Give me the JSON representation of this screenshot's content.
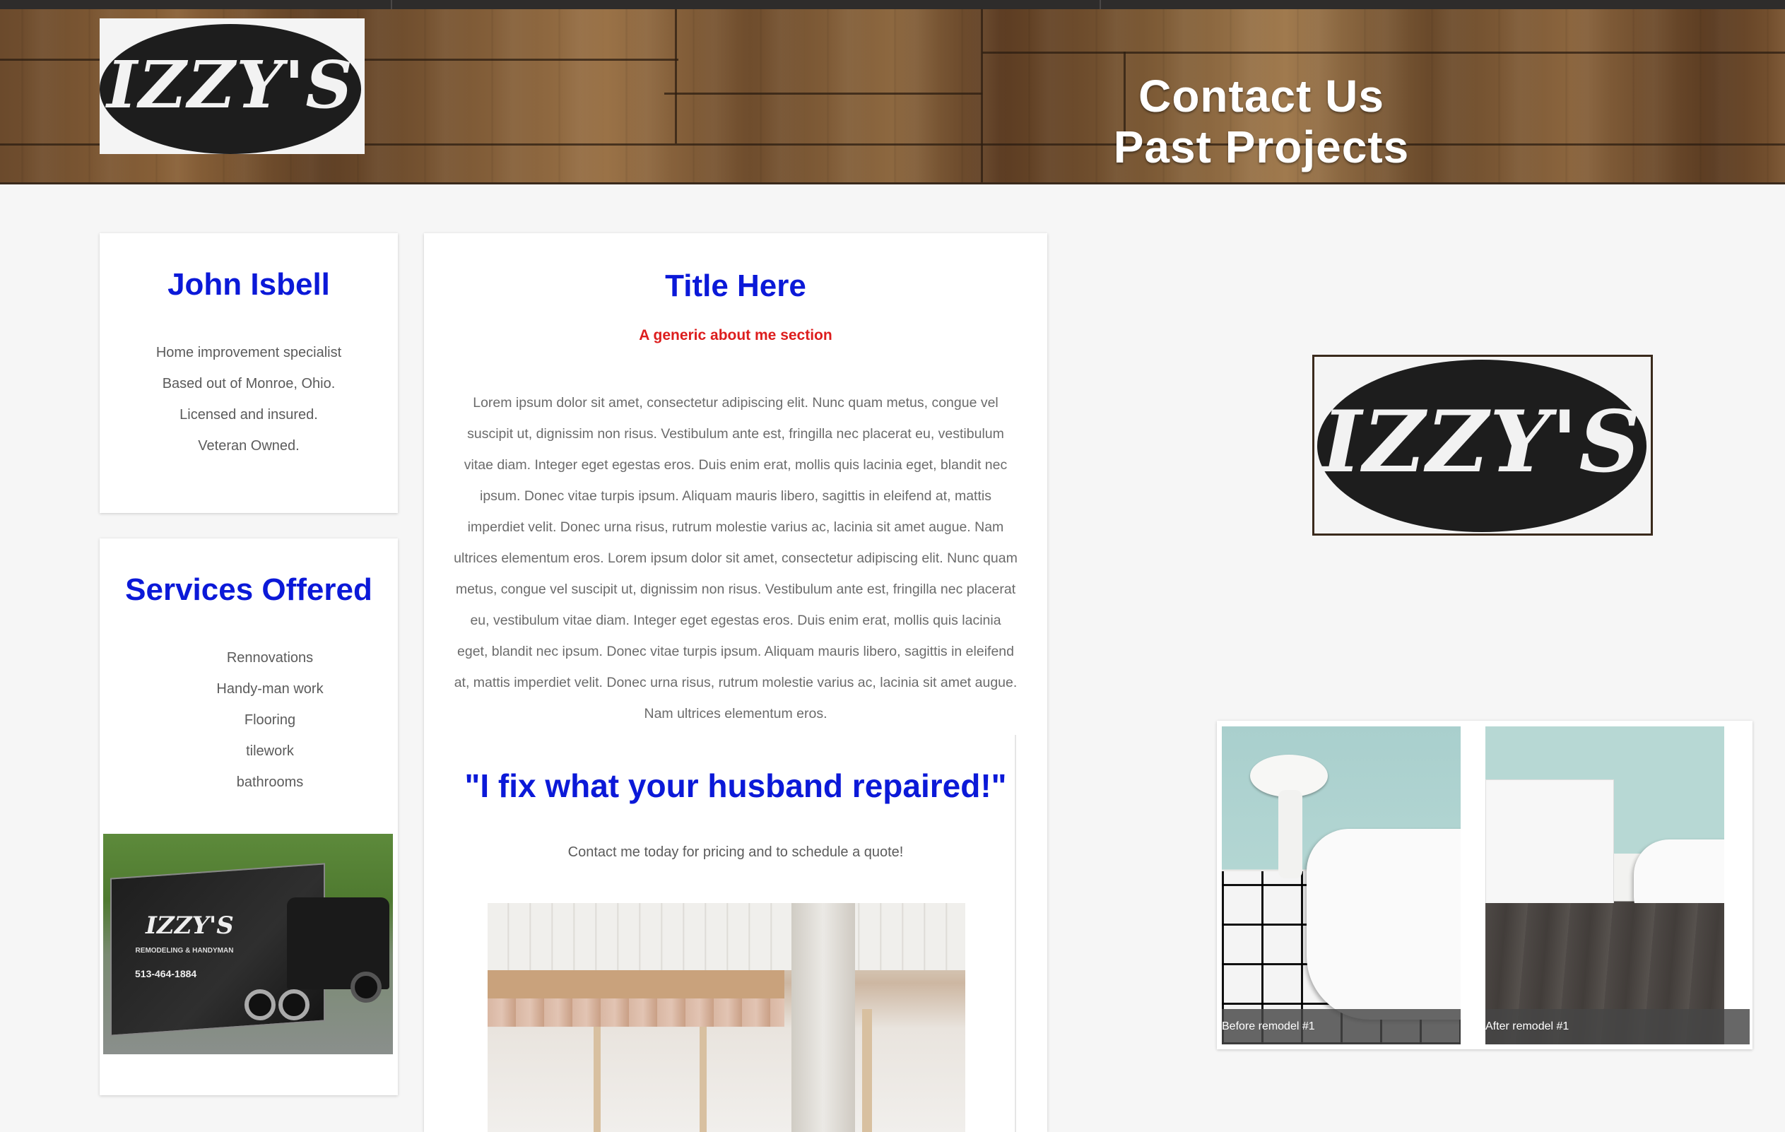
{
  "header": {
    "logo_text": "IZZY'S",
    "nav": [
      {
        "label": "Contact Us"
      },
      {
        "label": "Past Projects"
      }
    ]
  },
  "about_card": {
    "name": "John Isbell",
    "lines": [
      "Home improvement specialist",
      "Based out of Monroe, Ohio.",
      "Licensed and insured.",
      "Veteran Owned."
    ]
  },
  "services_card": {
    "heading": "Services Offered",
    "items": [
      "Rennovations",
      "Handy-man work",
      "Flooring",
      "tilework",
      "bathrooms"
    ]
  },
  "main_card": {
    "title": "Title Here",
    "subtitle": "A generic about me section",
    "paragraph": "Lorem ipsum dolor sit amet, consectetur adipiscing elit. Nunc quam metus, congue vel suscipit ut, dignissim non risus. Vestibulum ante est, fringilla nec placerat eu, vestibulum vitae diam. Integer eget egestas eros. Duis enim erat, mollis quis lacinia eget, blandit nec ipsum. Donec vitae turpis ipsum. Aliquam mauris libero, sagittis in eleifend at, mattis imperdiet velit. Donec urna risus, rutrum molestie varius ac, lacinia sit amet augue. Nam ultrices elementum eros. Lorem ipsum dolor sit amet, consectetur adipiscing elit. Nunc quam metus, congue vel suscipit ut, dignissim non risus. Vestibulum ante est, fringilla nec placerat eu, vestibulum vitae diam. Integer eget egestas eros. Duis enim erat, mollis quis lacinia eget, blandit nec ipsum. Donec vitae turpis ipsum. Aliquam mauris libero, sagittis in eleifend at, mattis imperdiet velit. Donec urna risus, rutrum molestie varius ac, lacinia sit amet augue. Nam ultrices elementum eros.",
    "quote": "\"I fix what your husband repaired!\"",
    "cta": "Contact me today for pricing and to schedule a quote!"
  },
  "gallery": {
    "captions": [
      "Before remodel #1",
      "After remodel #1"
    ]
  },
  "trailer": {
    "brand": "IZZY'S",
    "sub": "REMODELING & HANDYMAN",
    "phone": "513-464-1884"
  },
  "colors": {
    "accent_blue": "#0b19d8",
    "accent_red": "#dd1d1d",
    "page_bg": "#f6f6f6"
  }
}
